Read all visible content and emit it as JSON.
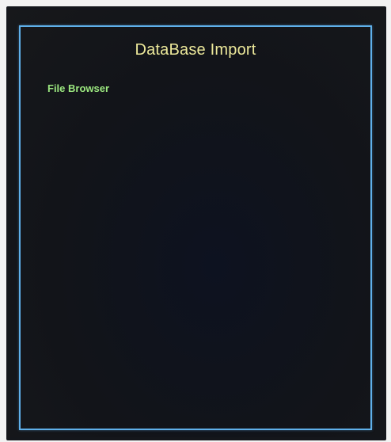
{
  "dialog": {
    "title": "DataBase Import",
    "section_label": "File Browser"
  },
  "colors": {
    "border": "#5fb0ea",
    "title": "#ece89a",
    "section_label": "#9be77f",
    "background": "#121419"
  }
}
